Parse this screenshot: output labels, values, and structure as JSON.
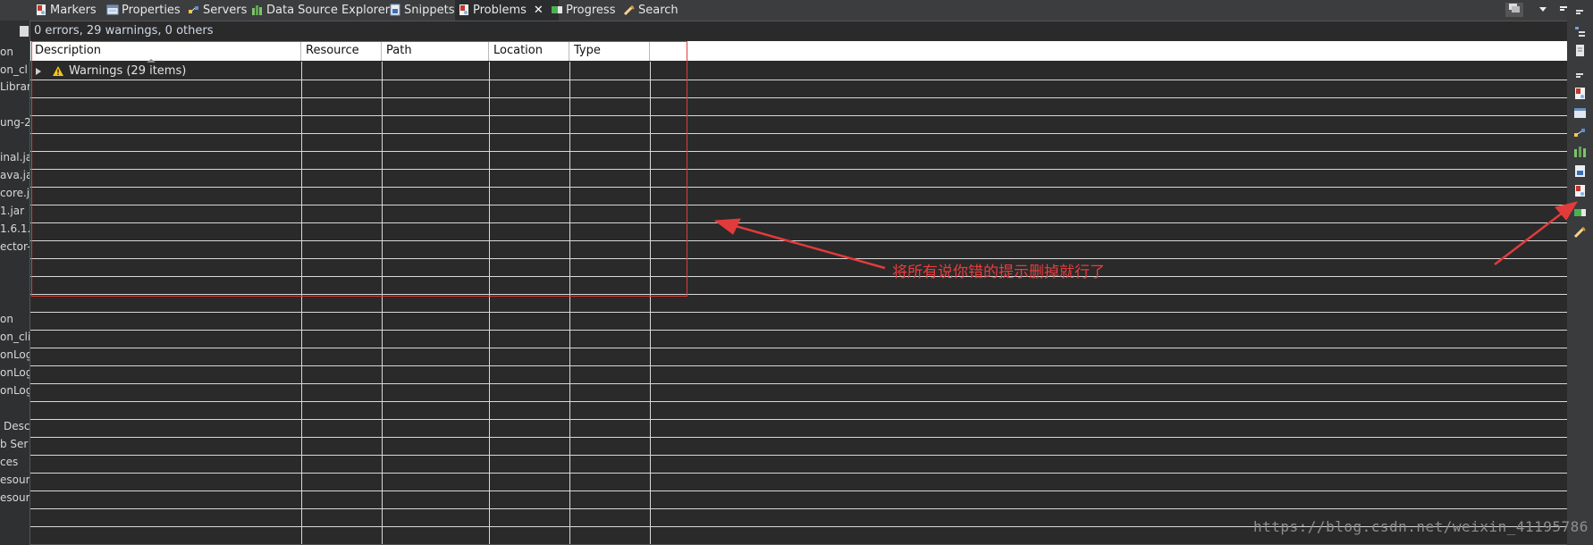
{
  "tabs": [
    {
      "label": "Markers",
      "icon": "markers-icon"
    },
    {
      "label": "Properties",
      "icon": "properties-icon"
    },
    {
      "label": "Servers",
      "icon": "servers-icon"
    },
    {
      "label": "Data Source Explorer",
      "icon": "data-source-icon"
    },
    {
      "label": "Snippets",
      "icon": "snippets-icon"
    },
    {
      "label": "Problems",
      "icon": "problems-icon",
      "close": "✕"
    },
    {
      "label": "Progress",
      "icon": "progress-icon"
    },
    {
      "label": "Search",
      "icon": "search-icon"
    }
  ],
  "summary": "0 errors, 29 warnings, 0 others",
  "columns": [
    "Description",
    "Resource",
    "Path",
    "Location",
    "Type"
  ],
  "tree": {
    "warnings_label": "Warnings (29 items)"
  },
  "left_panel_items": [
    "on",
    "on_cl",
    "Librar",
    "ung-2",
    "inal.ja",
    "ava.ja",
    "core.j",
    "1.jar",
    "1.6.1.",
    "ector-",
    "on",
    "on_clie",
    "onLog",
    "onLog",
    "onLog",
    "Desc",
    "b Ser",
    "ces",
    "esour",
    "esour"
  ],
  "annotation": {
    "text": "将所有说你错的提示删掉就行了",
    "color": "#ec3b3b"
  },
  "watermark": "https://blog.csdn.net/weixin_41195786",
  "colors": {
    "table_bg": "#2a2a2a",
    "header_bg": "#ffffff",
    "panel_bg": "#3a3b3d",
    "annotation_red": "#e23b3b"
  }
}
